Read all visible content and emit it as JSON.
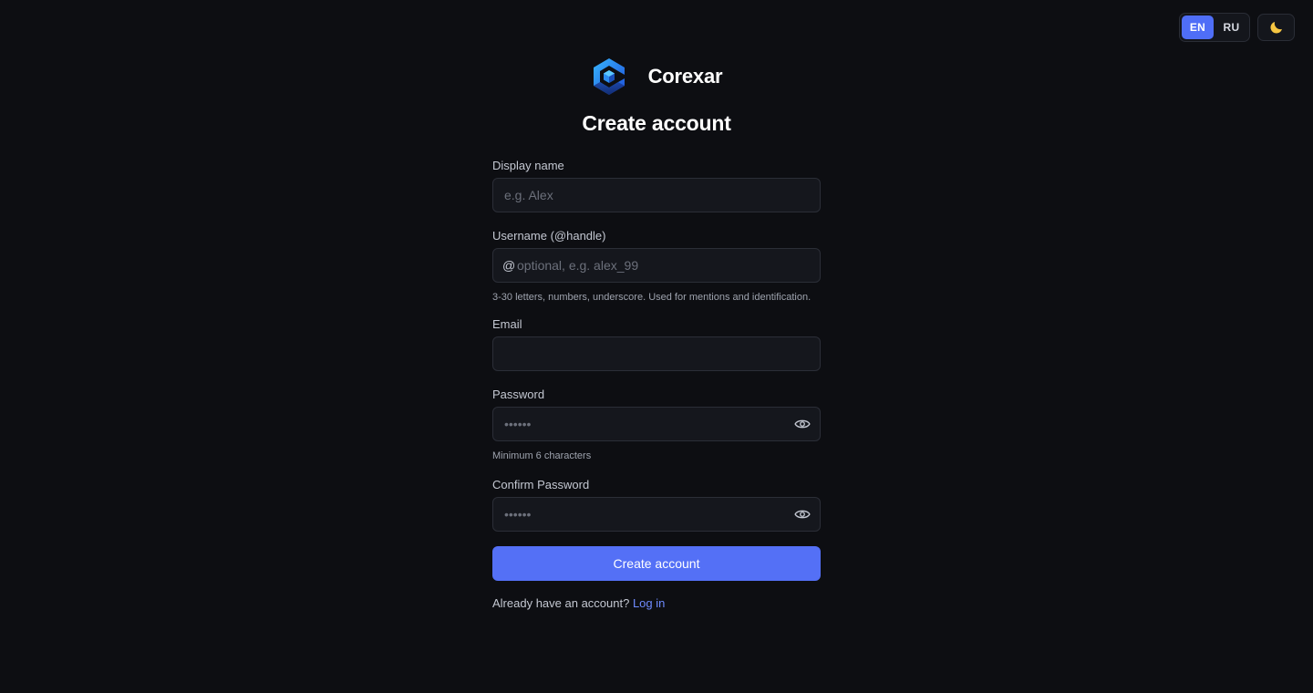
{
  "topbar": {
    "languages": [
      {
        "code": "EN",
        "active": true
      },
      {
        "code": "RU",
        "active": false
      }
    ],
    "theme_icon": "moon-icon"
  },
  "brand": {
    "name": "Corexar",
    "logo_icon": "hexagon-cube-logo"
  },
  "title": "Create account",
  "form": {
    "display_name": {
      "label": "Display name",
      "placeholder": "e.g. Alex",
      "value": ""
    },
    "username": {
      "label": "Username (@handle)",
      "prefix": "@",
      "placeholder": "optional, e.g. alex_99",
      "value": "",
      "hint": "3-30 letters, numbers, underscore. Used for mentions and identification."
    },
    "email": {
      "label": "Email",
      "placeholder": "",
      "value": ""
    },
    "password": {
      "label": "Password",
      "placeholder": "••••••",
      "value": "",
      "hint": "Minimum 6 characters",
      "toggle_icon": "eye-icon"
    },
    "confirm_password": {
      "label": "Confirm Password",
      "placeholder": "••••••",
      "value": "",
      "toggle_icon": "eye-icon"
    },
    "submit_label": "Create account"
  },
  "footer": {
    "prompt": "Already have an account?",
    "login_link": "Log in"
  },
  "colors": {
    "background": "#0d0e12",
    "accent": "#5470f6",
    "link": "#6f8bff",
    "input_bg": "#15171d"
  }
}
